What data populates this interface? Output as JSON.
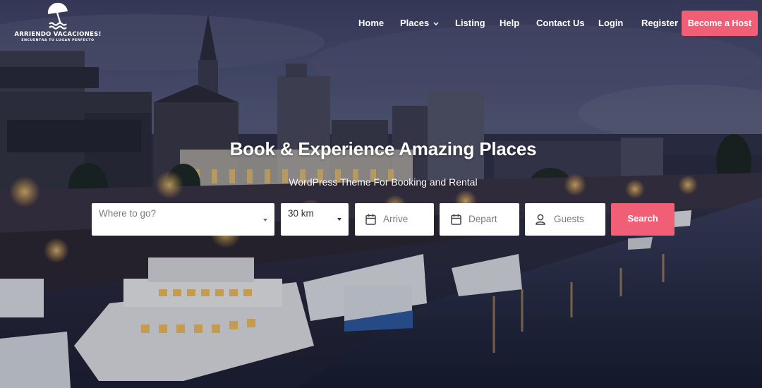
{
  "brand": {
    "name": "ARRIENDO VACACIONES!",
    "tagline": "ENCUENTRA TU LUGAR PERFECTO",
    "logo_icon": "beach-umbrella-waves-icon"
  },
  "nav": {
    "items": [
      "Home",
      "Places",
      "Listing",
      "Help",
      "Contact Us",
      "Login",
      "Register"
    ],
    "places_dropdown_icon": "chevron-down-icon",
    "cta_label": "Become a Host"
  },
  "hero": {
    "title": "Book & Experience Amazing Places",
    "subtitle": "WordPress Theme For Booking and Rental"
  },
  "search": {
    "where_placeholder": "Where to go?",
    "radius_value": "30 km",
    "arrive_placeholder": "Arrive",
    "depart_placeholder": "Depart",
    "guests_placeholder": "Guests",
    "submit_label": "Search"
  },
  "colors": {
    "accent": "#f05f76",
    "text_on_dark": "#ffffff",
    "field_bg": "#ffffff",
    "placeholder": "#7a7a7a"
  }
}
